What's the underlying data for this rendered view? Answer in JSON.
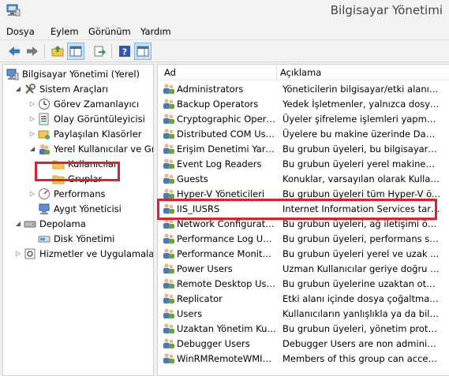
{
  "window": {
    "title": "Bilgisayar Yönetimi"
  },
  "menu": [
    "Dosya",
    "Eylem",
    "Görünüm",
    "Yardım"
  ],
  "tree": [
    {
      "label": "Bilgisayar Yönetimi (Yerel)",
      "arrow": "",
      "icon": "computer-icon"
    },
    {
      "label": "Sistem Araçları",
      "arrow": "◢",
      "icon": "tools-icon"
    },
    {
      "label": "Görev Zamanlayıcı",
      "arrow": "▷",
      "icon": "clock-icon"
    },
    {
      "label": "Olay Görüntüleyicisi",
      "arrow": "▷",
      "icon": "event-viewer-icon"
    },
    {
      "label": "Paylaşılan Klasörler",
      "arrow": "▷",
      "icon": "shared-folder-icon"
    },
    {
      "label": "Yerel Kullanıcılar ve Gru",
      "arrow": "◢",
      "icon": "users-icon"
    },
    {
      "label": "Kullanıcılar",
      "arrow": "",
      "icon": "folder-icon"
    },
    {
      "label": "Gruplar",
      "arrow": "",
      "icon": "folder-icon"
    },
    {
      "label": "Performans",
      "arrow": "▷",
      "icon": "performance-icon"
    },
    {
      "label": "Aygıt Yöneticisi",
      "arrow": "",
      "icon": "device-manager-icon"
    },
    {
      "label": "Depolama",
      "arrow": "◢",
      "icon": "storage-icon"
    },
    {
      "label": "Disk Yönetimi",
      "arrow": "",
      "icon": "disk-icon"
    },
    {
      "label": "Hizmetler ve Uygulamalar",
      "arrow": "▷",
      "icon": "services-icon"
    }
  ],
  "columns": {
    "name": "Ad",
    "description": "Açıklama"
  },
  "groups": [
    {
      "name": "Administrators",
      "description": "Yöneticilerin bilgisayar/etki alanın..."
    },
    {
      "name": "Backup Operators",
      "description": "Yedek İşletmenler, yalnızca dosya ..."
    },
    {
      "name": "Cryptographic Operat...",
      "description": "Üyeler şifreleme işlemleri yapmay..."
    },
    {
      "name": "Distributed COM Users",
      "description": "Üyelere bu makine üzerinde Dağıt..."
    },
    {
      "name": "Erişim Denetimi Yardı...",
      "description": "Bu grubun üyeleri, bu bilgisayard..."
    },
    {
      "name": "Event Log Readers",
      "description": "Bu grubun üyeleri yerel makinede..."
    },
    {
      "name": "Guests",
      "description": "Konuklar, varsayılan olarak Kullanı..."
    },
    {
      "name": "Hyper-V Yöneticileri",
      "description": "Bu grubun üyeleri tüm Hyper-V ö..."
    },
    {
      "name": "IIS_IUSRS",
      "description": "Internet Information Services taraf..."
    },
    {
      "name": "Network Configuratio...",
      "description": "Bu grubun üyeleri, ağ iletişimi öze..."
    },
    {
      "name": "Performance Log Users",
      "description": "Bu grubun üyeleri, performans sa..."
    },
    {
      "name": "Performance Monitor ...",
      "description": "Bu grubun üyeleri yerel ve uzak ..."
    },
    {
      "name": "Power Users",
      "description": "Uzman Kullanıcılar geriye doğru u..."
    },
    {
      "name": "Remote Desktop Users",
      "description": "Bu grubun üyelerine uzaktan otur..."
    },
    {
      "name": "Replicator",
      "description": "Etki alanı içinde dosya çoğaltması..."
    },
    {
      "name": "Users",
      "description": "Kullanıcıların yanlışlıkla ya da bile..."
    },
    {
      "name": "Uzaktan Yönetim Kull...",
      "description": "Bu grubun üyeleri, yönetim proto..."
    },
    {
      "name": "Debugger Users",
      "description": "Debugger Users are non administr..."
    },
    {
      "name": "WinRMRemoteWMIU...",
      "description": "Members of this group can acces..."
    }
  ],
  "colors": {
    "highlight": "#d9232e",
    "toolbar_active": "#cce4f7"
  }
}
